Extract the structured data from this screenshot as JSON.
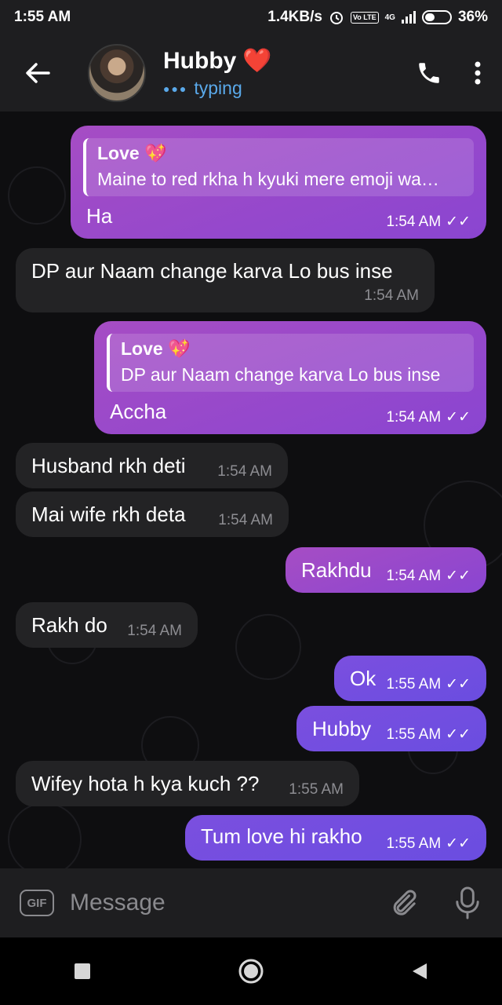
{
  "status": {
    "time": "1:55 AM",
    "speed": "1.4KB/s",
    "network": "4G",
    "volte": "Vo LTE",
    "battery": "36%"
  },
  "header": {
    "name": "Hubby",
    "typing": "typing",
    "heart": "❤️"
  },
  "messages": [
    {
      "dir": "out",
      "reply_name": "Love 💖",
      "reply_text": "Maine to red rkha h kyuki mere emoji wa…",
      "text": "Ha",
      "time": "1:54 AM"
    },
    {
      "dir": "in",
      "text": "DP aur Naam change karva Lo bus inse",
      "time": "1:54 AM"
    },
    {
      "dir": "out",
      "reply_name": "Love 💖",
      "reply_text": "DP aur Naam change karva Lo bus inse",
      "text": "Accha",
      "time": "1:54 AM"
    },
    {
      "dir": "in",
      "text": "Husband rkh deti",
      "time": "1:54 AM"
    },
    {
      "dir": "in",
      "text": "Mai wife rkh deta",
      "time": "1:54 AM"
    },
    {
      "dir": "out",
      "text": "Rakhdu",
      "time": "1:54 AM"
    },
    {
      "dir": "in",
      "text": "Rakh do",
      "time": "1:54 AM"
    },
    {
      "dir": "out",
      "text": "Ok",
      "time": "1:55 AM"
    },
    {
      "dir": "out",
      "text": "Hubby",
      "time": "1:55 AM"
    },
    {
      "dir": "in",
      "text": "Wifey hota h kya kuch ??",
      "time": "1:55 AM"
    },
    {
      "dir": "out",
      "text": "Tum love hi rakho",
      "time": "1:55 AM"
    }
  ],
  "input": {
    "gif_label": "GIF",
    "placeholder": "Message"
  },
  "icons": [
    "back-arrow-icon",
    "phone-icon",
    "more-vert-icon",
    "gif-icon",
    "attach-icon",
    "mic-icon",
    "read-check-icon"
  ]
}
